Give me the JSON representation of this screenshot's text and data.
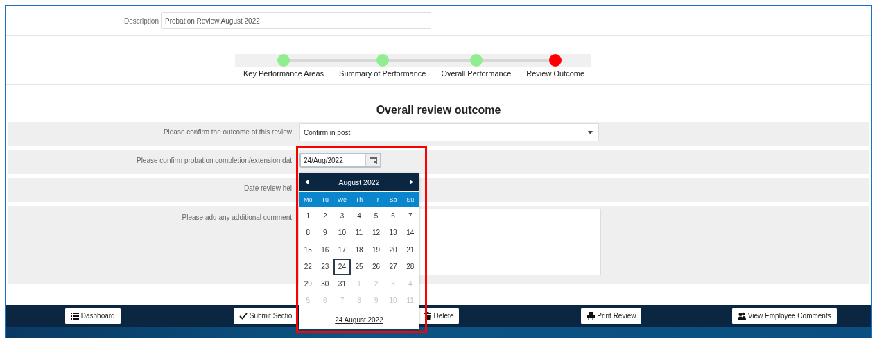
{
  "description": {
    "label": "Description",
    "value": "Probation Review August 2022"
  },
  "steps": [
    {
      "label": "Key Performance Areas",
      "color": "#90ee90"
    },
    {
      "label": "Summary of Performance",
      "color": "#90ee90"
    },
    {
      "label": "Overall Performance",
      "color": "#90ee90"
    },
    {
      "label": "Review Outcome",
      "color": "#ff0000"
    }
  ],
  "heading": "Overall review outcome",
  "form": [
    {
      "kind": "select",
      "label": "Please confirm the outcome of this review",
      "value": "Confirm in post"
    },
    {
      "kind": "date",
      "label": "Please confirm probation completion/extension dat",
      "value": "24/Aug/2022"
    },
    {
      "kind": "plain",
      "label": "Date review hel"
    },
    {
      "kind": "textarea",
      "label": "Please add any additional comment"
    }
  ],
  "datepicker": {
    "month": "August 2022",
    "weekdays": [
      "Mo",
      "Tu",
      "We",
      "Th",
      "Fr",
      "Sa",
      "Su"
    ],
    "weeks": [
      [
        {
          "day": "1",
          "outside": false,
          "selected": false
        },
        {
          "day": "2",
          "outside": false,
          "selected": false
        },
        {
          "day": "3",
          "outside": false,
          "selected": false
        },
        {
          "day": "4",
          "outside": false,
          "selected": false
        },
        {
          "day": "5",
          "outside": false,
          "selected": false
        },
        {
          "day": "6",
          "outside": false,
          "selected": false
        },
        {
          "day": "7",
          "outside": false,
          "selected": false
        }
      ],
      [
        {
          "day": "8",
          "outside": false,
          "selected": false
        },
        {
          "day": "9",
          "outside": false,
          "selected": false
        },
        {
          "day": "10",
          "outside": false,
          "selected": false
        },
        {
          "day": "11",
          "outside": false,
          "selected": false
        },
        {
          "day": "12",
          "outside": false,
          "selected": false
        },
        {
          "day": "13",
          "outside": false,
          "selected": false
        },
        {
          "day": "14",
          "outside": false,
          "selected": false
        }
      ],
      [
        {
          "day": "15",
          "outside": false,
          "selected": false
        },
        {
          "day": "16",
          "outside": false,
          "selected": false
        },
        {
          "day": "17",
          "outside": false,
          "selected": false
        },
        {
          "day": "18",
          "outside": false,
          "selected": false
        },
        {
          "day": "19",
          "outside": false,
          "selected": false
        },
        {
          "day": "20",
          "outside": false,
          "selected": false
        },
        {
          "day": "21",
          "outside": false,
          "selected": false
        }
      ],
      [
        {
          "day": "22",
          "outside": false,
          "selected": false
        },
        {
          "day": "23",
          "outside": false,
          "selected": false
        },
        {
          "day": "24",
          "outside": false,
          "selected": true
        },
        {
          "day": "25",
          "outside": false,
          "selected": false
        },
        {
          "day": "26",
          "outside": false,
          "selected": false
        },
        {
          "day": "27",
          "outside": false,
          "selected": false
        },
        {
          "day": "28",
          "outside": false,
          "selected": false
        }
      ],
      [
        {
          "day": "29",
          "outside": false,
          "selected": false
        },
        {
          "day": "30",
          "outside": false,
          "selected": false
        },
        {
          "day": "31",
          "outside": false,
          "selected": false
        },
        {
          "day": "1",
          "outside": true,
          "selected": false
        },
        {
          "day": "2",
          "outside": true,
          "selected": false
        },
        {
          "day": "3",
          "outside": true,
          "selected": false
        },
        {
          "day": "4",
          "outside": true,
          "selected": false
        }
      ],
      [
        {
          "day": "5",
          "outside": true,
          "selected": false
        },
        {
          "day": "6",
          "outside": true,
          "selected": false
        },
        {
          "day": "7",
          "outside": true,
          "selected": false
        },
        {
          "day": "8",
          "outside": true,
          "selected": false
        },
        {
          "day": "9",
          "outside": true,
          "selected": false
        },
        {
          "day": "10",
          "outside": true,
          "selected": false
        },
        {
          "day": "11",
          "outside": true,
          "selected": false
        }
      ]
    ],
    "today_link": "24 August 2022"
  },
  "buttons": [
    {
      "kind": "list",
      "label": "Dashboard"
    },
    {
      "kind": "check",
      "label": "Submit Sectio"
    },
    {
      "kind": "trash",
      "label": "Delete"
    },
    {
      "kind": "printer",
      "label": "Print Review"
    },
    {
      "kind": "users",
      "label": "View Employee Comments"
    }
  ]
}
